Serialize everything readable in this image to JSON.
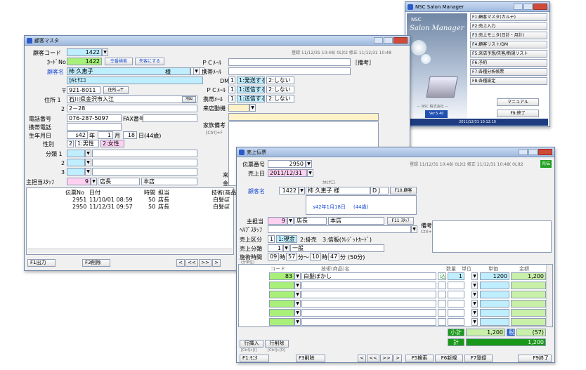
{
  "customer": {
    "title": "顧客マスタ",
    "code_label": "顧客コード",
    "code": "1422",
    "card_label": "ｶｰﾄﾞNo",
    "card": "1422",
    "btn_empty": "空番検索",
    "btn_lost": "失客にする",
    "name_label": "顧客名",
    "name": "柿 久恵子",
    "honorific": "様",
    "kana": "ｶｷﾋｻｴｺ",
    "zip_mark": "〒",
    "zip": "921-8011",
    "zip_btn": "住所→〒",
    "addr1_label": "住所 1",
    "addr1": "石川県金沢市入江",
    "addr1_btn": "地図",
    "addr2_label": "2",
    "addr2": "2－28",
    "tel_label": "電話番号",
    "tel": "076-287-5097",
    "fax_label": "FAX番号",
    "mobile_label": "携帯電話",
    "birth_label": "生年月日",
    "birth_era": "s42",
    "birth_year_unit": "年",
    "birth_month": "1",
    "birth_month_unit": "月",
    "birth_day": "18",
    "birth_day_unit": "日(44歳)",
    "gender_label": "性別",
    "gender_val": "2",
    "gender_opt1": "1:男性",
    "gender_opt2": "2:女性",
    "class1_label": "分類 1",
    "class2_label": "2",
    "class3_label": "3",
    "staff_label": "主担当ｽﾀｯﾌ",
    "staff_code": "9",
    "staff_name": "店長",
    "store": "本店",
    "status": "登録 11/12/31 10:48( 0L)t2 修正 11/12/31 10:48",
    "pcmail_label": "ＰＣﾒｰﾙ",
    "memo_label": "［備考］",
    "mobmail_label": "携帯ﾒｰﾙ",
    "dm_label": "DM",
    "dm_val": "1",
    "send1": "1:発送する",
    "send2": "2:しない",
    "pcmail2_label": "ＰＣﾒｰﾙ",
    "pcmail2_val": "1",
    "ok1": "1:送信する",
    "ok2": "2:しない",
    "mob2_label": "携帯ﾒｰﾙ",
    "mob2_val": "1",
    "visit_label": "来店動機",
    "family_label": "家族備考",
    "family_sub": "[Ctrl]+F",
    "grid_headers": [
      "伝票No",
      "日付",
      "時間",
      "担当",
      "技術(商品"
    ],
    "rows": [
      [
        "2951",
        "11/10/01 08:59",
        "50",
        "店長",
        "白髪ぼ"
      ],
      [
        "2950",
        "11/12/31 09:57",
        "50",
        "店長",
        "白髪ぼ"
      ]
    ],
    "side1": "来",
    "side2": "金",
    "f_print": "F1出力",
    "f_del": "F3削除",
    "nav": [
      "<",
      "<<",
      ">>",
      ">"
    ]
  },
  "menu": {
    "title": "NSC Salon Manager",
    "logo1": "NSC",
    "logo2": "Salon Manager",
    "items": [
      "F1:顧客マスタ(カルテ)",
      "F2:売上入力",
      "F3:売上モニタ(日計・月計)",
      "F4:顧客リスト/DM",
      "F5:来店予想/失客/新規リスト",
      "F6:予約",
      "F7:各種分析帳票",
      "F8:各種設定"
    ],
    "manual": "マニュアル",
    "exit": "F9:終了",
    "foot1": "－ NSC 株式会社 －",
    "ver": "Ver.5.40",
    "datetime": "2011/12/31 10:12:10"
  },
  "sales": {
    "title": "売上伝票",
    "slip_label": "伝票番号",
    "slip": "2950",
    "date_label": "売上日",
    "date": "2011/12/31",
    "status": "登録 11/12/31 10:48( 0L)t2 修正 11/12/31 10:48( 0L)t2",
    "badge": "売伝",
    "kana": "ｶｷﾋｻｴｺ",
    "cust_label": "顧客名",
    "cust_code": "1422",
    "cust_name": "柿 久恵子 様",
    "dj": "D J",
    "f10": "F10.顧客",
    "birth": "s42年1月18日",
    "age": "(44歳)",
    "staff_label": "主担当",
    "staff_code": "9",
    "staff_name": "店長",
    "store": "本店",
    "f11": "F11 ｽﾀｯﾌ",
    "help_label": "ﾍﾙﾌﾟｽﾀｯﾌ",
    "memo_label": "備考",
    "memo_sub": "Ctrl+M",
    "kind_label": "売上区分",
    "kind_val": "1",
    "k1": "1:現金",
    "k2": "2:掛売",
    "k3": "3:信販(ｸﾚｼﾞｯﾄｶｰﾄﾞ)",
    "cls_label": "売上分類",
    "cls_val": "1",
    "cls_name": "一般",
    "time_label": "施術時間",
    "time_sub": "(分単位)",
    "t_h1": "09",
    "t_hu": "時",
    "t_m1": "57",
    "t_mu": "分～",
    "t_h2": "10",
    "t_m2": "47",
    "t_mu2": "分",
    "t_total": "(50分)",
    "hdr": [
      "コード",
      "技術(商品)名",
      "数量",
      "単位",
      "単価",
      "金額"
    ],
    "line1": {
      "code": "83",
      "name": "白髪ぼかし",
      "tax": "込",
      "qty": "1",
      "price": "1200",
      "amount": "1,200"
    },
    "sub_label": "小計",
    "sub_val": "1,200",
    "sub_mark": "税",
    "sub_count": "(57)",
    "tot_label": "計",
    "tot_val": "1,200",
    "btn_ins": "行挿入",
    "btn_del": "行削除",
    "ins_sub": "[Ctrl]+[I]",
    "del_sub": "[Ctrl]+[D]",
    "f1": "F1:ﾓﾆﾀ",
    "f3": "F3削除",
    "nav": [
      "<",
      "<<",
      ">>",
      ">"
    ],
    "f5": "F5検索",
    "f6": "F6新規",
    "f7": "F7登録",
    "f9": "F9終了"
  }
}
